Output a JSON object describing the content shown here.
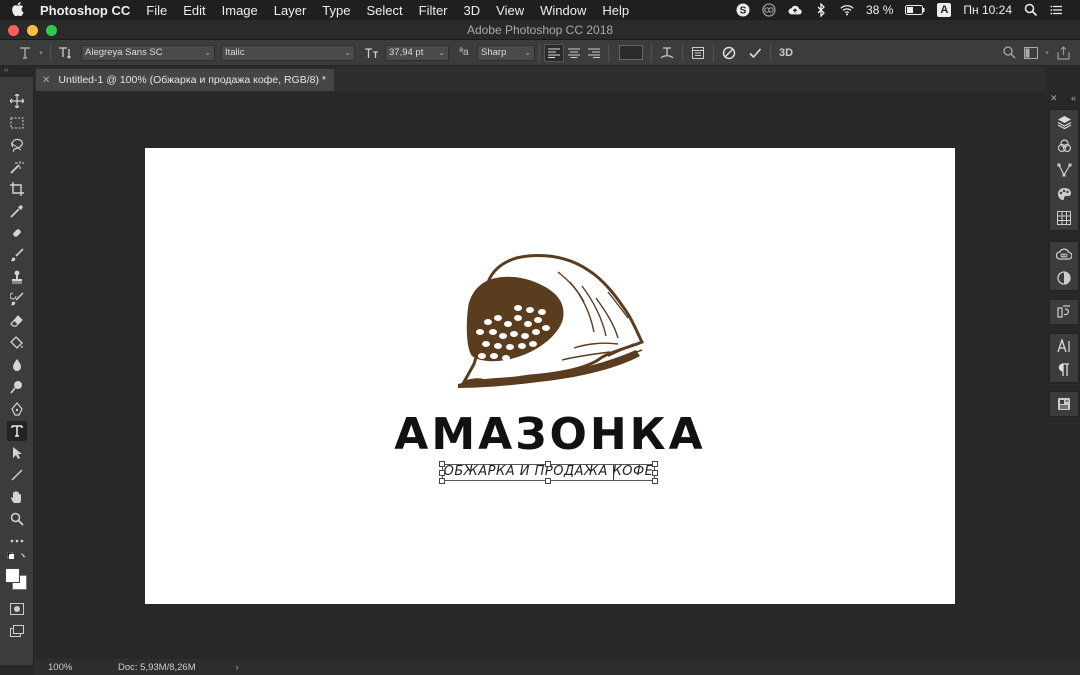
{
  "menubar": {
    "app_name": "Photoshop CC",
    "items": [
      "File",
      "Edit",
      "Image",
      "Layer",
      "Type",
      "Select",
      "Filter",
      "3D",
      "View",
      "Window",
      "Help"
    ],
    "battery": "38 %",
    "input_source": "A",
    "clock": "Пн 10:24"
  },
  "window": {
    "title": "Adobe Photoshop CC 2018"
  },
  "options": {
    "font_family": "Alegreya Sans SC",
    "font_style": "Italic",
    "font_size": "37,94 pt",
    "aa_label": "ªa",
    "anti_alias": "Sharp",
    "three_d": "3D"
  },
  "document": {
    "tab_title": "Untitled-1 @ 100% (Обжарка и продажа кофе, RGB/8) *",
    "headline": "АМАЗОНКА",
    "tagline": "ОБЖАРКА И ПРОДАЖА КОФЕ"
  },
  "status": {
    "zoom": "100%",
    "doc_info": "Doc: 5,93M/8,26M",
    "arrow": "›"
  },
  "colors": {
    "coffee_brown": "#5a3d1f",
    "ui_dark": "#282828",
    "ui_panel": "#3c3c3c",
    "menubar": "#1f1f1f"
  }
}
